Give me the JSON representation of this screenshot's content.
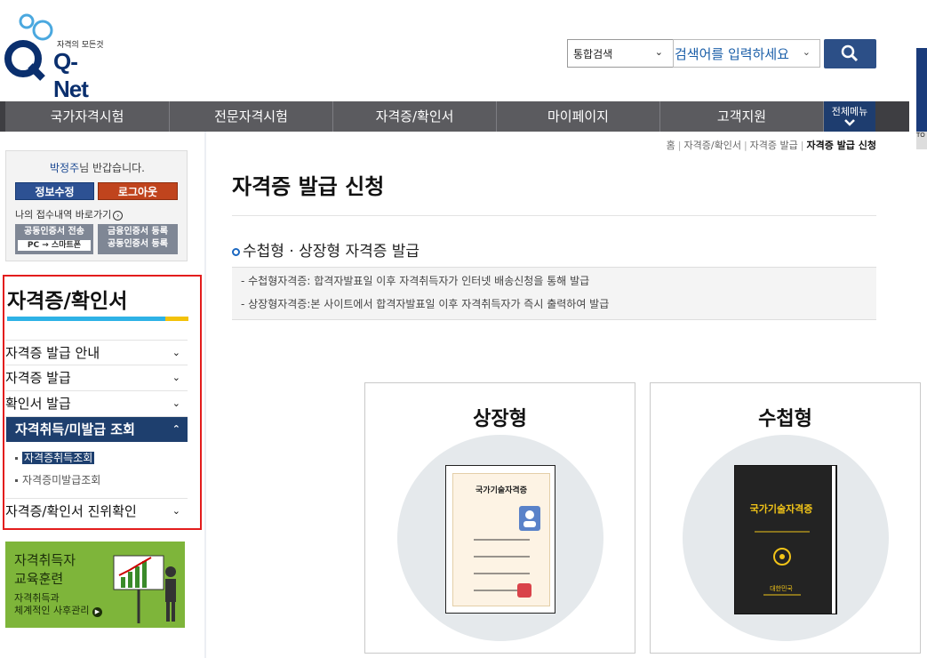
{
  "header": {
    "logo_text": "Q-Net",
    "logo_tagline": "자격의 모든것",
    "search_scope": "통합검색",
    "search_placeholder": "검색어를 입력하세요"
  },
  "gnb": {
    "items": [
      "국가자격시험",
      "전문자격시험",
      "자격증/확인서",
      "마이페이지",
      "고객지원"
    ],
    "all_menu": "전체메뉴"
  },
  "user_box": {
    "user_name": "박정주",
    "greeting": "님 반갑습니다.",
    "edit_label": "정보수정",
    "logout_label": "로그아웃",
    "recent_link": "나의 접수내역 바로가기",
    "cert_transfer_top": "공동인증서 전송",
    "cert_transfer_sub": "PC → 스마트폰",
    "cert_register_line1": "금융인증서 등록",
    "cert_register_line2": "공동인증서 등록"
  },
  "side_nav": {
    "title": "자격증/확인서",
    "items": [
      "자격증 발급 안내",
      "자격증 발급",
      "확인서 발급"
    ],
    "active": "자격취득/미발급 조회",
    "sub_items": [
      "자격증취득조회",
      "자격증미발급조회"
    ],
    "last_item": "자격증/확인서 진위확인"
  },
  "banner": {
    "line1": "자격취득자",
    "line2": "교육훈련",
    "line3": "자격취득과",
    "line4": "체계적인 사후관리"
  },
  "breadcrumb": [
    "홈",
    "자격증/확인서",
    "자격증 발급",
    "자격증 발급 신청"
  ],
  "main": {
    "title": "자격증 발급 신청",
    "section_heading": "수첩형 · 상장형 자격증 발급",
    "info_lines": [
      "- 수첩형자격증: 합격자발표일 이후 자격취득자가 인터넷 배송신청을 통해 발급",
      "- 상장형자격증:본 사이트에서 합격자발표일 이후 자격취득자가 즉시 출력하여 발급"
    ]
  },
  "cards": {
    "sangjang": {
      "title": "상장형",
      "doc_title": "국가기술자격증"
    },
    "sucheop": {
      "title": "수첩형",
      "book_title": "국가기술자격증",
      "book_sub": "대한민국"
    }
  },
  "colors": {
    "brand_navy": "#1e3f6e",
    "gnb_bg": "#5b5b5f",
    "highlight_red": "#e31d1d",
    "accent_blue": "#2eb2e6",
    "accent_yellow": "#f3c20a"
  }
}
